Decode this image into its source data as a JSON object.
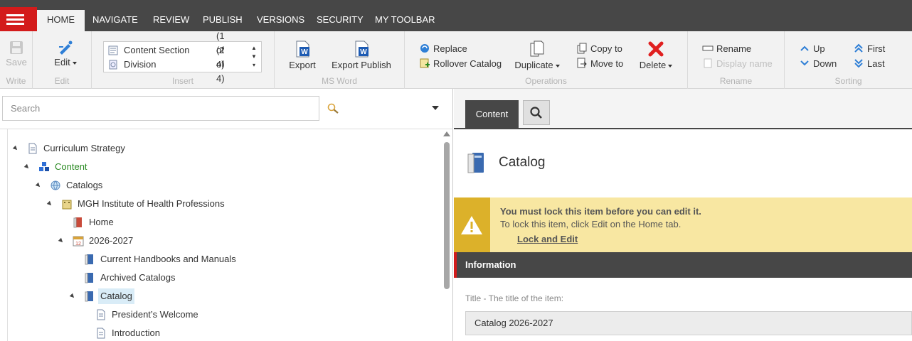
{
  "nav": {
    "tabs": [
      "HOME",
      "NAVIGATE",
      "REVIEW",
      "PUBLISH",
      "VERSIONS",
      "SECURITY",
      "MY TOOLBAR"
    ],
    "active": "HOME"
  },
  "ribbon": {
    "write": {
      "save": "Save",
      "group": "Write"
    },
    "edit": {
      "edit": "Edit",
      "group": "Edit"
    },
    "insert": {
      "group": "Insert",
      "items": [
        {
          "label": "Content Section",
          "count": "(1 of 4)"
        },
        {
          "label": "Division",
          "count": "(2 of 4)"
        }
      ]
    },
    "msword": {
      "export": "Export",
      "export_publish": "Export Publish",
      "group": "MS Word"
    },
    "operations": {
      "replace": "Replace",
      "rollover": "Rollover Catalog",
      "duplicate": "Duplicate",
      "copy_to": "Copy to",
      "move_to": "Move to",
      "delete": "Delete",
      "group": "Operations"
    },
    "rename": {
      "rename": "Rename",
      "display_name": "Display name",
      "group": "Rename"
    },
    "sorting": {
      "up": "Up",
      "down": "Down",
      "first": "First",
      "last": "Last",
      "group": "Sorting"
    }
  },
  "search": {
    "placeholder": "Search"
  },
  "tree": {
    "root": "Curriculum Strategy",
    "content": "Content",
    "catalogs": "Catalogs",
    "institute": "MGH Institute of Health Professions",
    "home": "Home",
    "year": "2026-2027",
    "handbooks": "Current Handbooks and Manuals",
    "archived": "Archived Catalogs",
    "catalog": "Catalog",
    "welcome": "President’s Welcome",
    "introduction": "Introduction"
  },
  "editor": {
    "tab_content": "Content",
    "item_title": "Catalog",
    "warning_title": "You must lock this item before you can edit it.",
    "warning_text": "To lock this item, click Edit on the Home tab.",
    "warning_link": "Lock and Edit",
    "section": "Information",
    "field_label": "Title - The title of the item:",
    "field_value": "Catalog 2026-2027"
  },
  "colors": {
    "accent": "#d31b1b",
    "dark": "#474747",
    "warning": "#f8e7a2"
  }
}
